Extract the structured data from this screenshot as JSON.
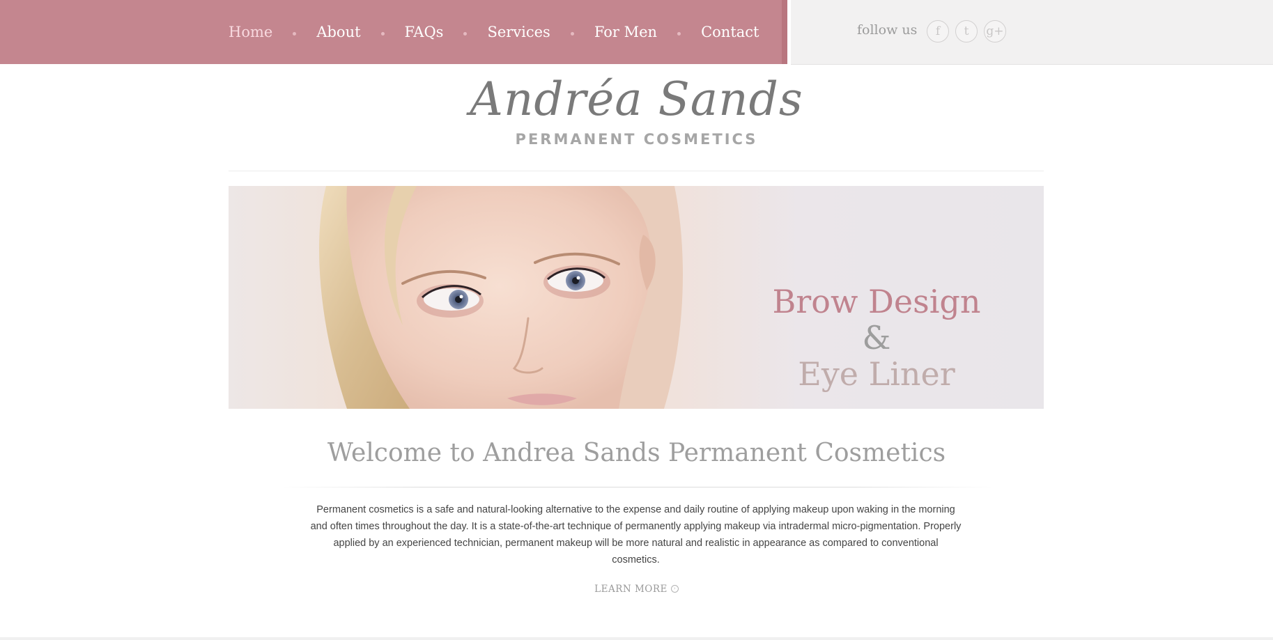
{
  "nav": {
    "items": [
      {
        "label": "Home",
        "active": true
      },
      {
        "label": "About"
      },
      {
        "label": "FAQs"
      },
      {
        "label": "Services"
      },
      {
        "label": "For Men"
      },
      {
        "label": "Contact"
      }
    ]
  },
  "follow": {
    "label": "follow us",
    "icons": [
      "facebook-icon",
      "twitter-icon",
      "google-plus-icon"
    ],
    "glyphs": [
      "f",
      "t",
      "g+"
    ]
  },
  "logo": {
    "name": "Andréa Sands",
    "subtitle": "PERMANENT COSMETICS"
  },
  "hero": {
    "title_line1": "Brow Design",
    "ampersand": "&",
    "title_line2": "Eye Liner"
  },
  "welcome": {
    "heading": "Welcome to Andrea Sands Permanent Cosmetics",
    "body": "Permanent cosmetics is a safe and natural-looking alternative to the expense and daily routine of applying makeup upon waking in the morning and often times throughout the day. It is a state-of-the-art technique of permanently applying makeup via intradermal micro-pigmentation. Properly applied by an experienced technician, permanent makeup will be more natural and realistic in appearance as compared to conventional cosmetics.",
    "learn_more": "LEARN MORE"
  },
  "colors": {
    "nav_bg": "#c4868f",
    "accent": "#c0838e",
    "follow_bg": "#f2f1f1"
  }
}
